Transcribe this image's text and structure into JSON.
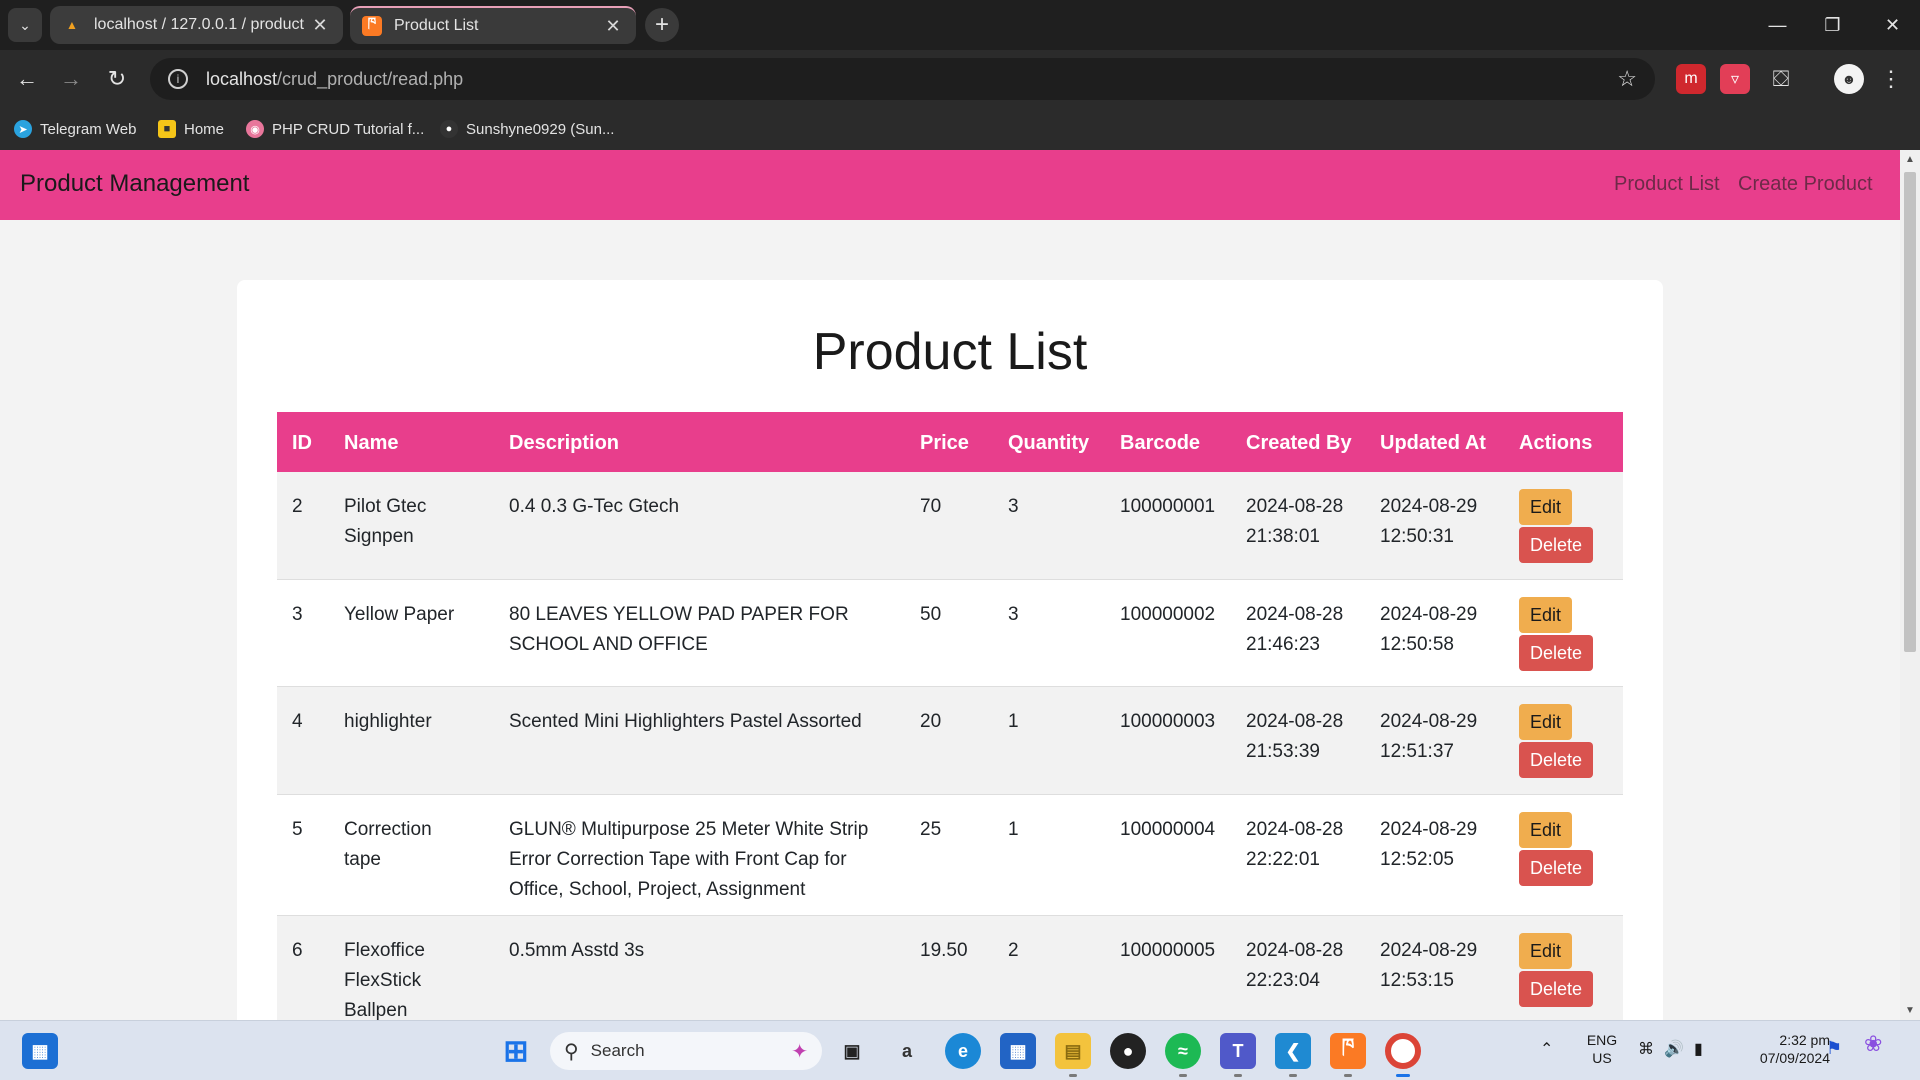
{
  "browser": {
    "tabs": [
      {
        "title": "localhost / 127.0.0.1 / product |",
        "active": false
      },
      {
        "title": "Product List",
        "active": true
      }
    ],
    "url_host": "localhost",
    "url_path": "/crud_product/read.php",
    "bookmarks": [
      "Telegram Web",
      "Home",
      "PHP CRUD Tutorial f...",
      "Sunshyne0929 (Sun..."
    ]
  },
  "navbar": {
    "brand": "Product Management",
    "links": [
      "Product List",
      "Create Product"
    ]
  },
  "page": {
    "title": "Product List",
    "columns": [
      "ID",
      "Name",
      "Description",
      "Price",
      "Quantity",
      "Barcode",
      "Created By",
      "Updated At",
      "Actions"
    ],
    "edit_label": "Edit",
    "delete_label": "Delete",
    "rows": [
      {
        "id": "2",
        "name": "Pilot Gtec Signpen",
        "description": "0.4 0.3 G-Tec Gtech",
        "price": "70",
        "quantity": "3",
        "barcode": "100000001",
        "created": "2024-08-28 21:38:01",
        "updated": "2024-08-29 12:50:31"
      },
      {
        "id": "3",
        "name": "Yellow Paper",
        "description": "80 LEAVES YELLOW PAD PAPER FOR SCHOOL AND OFFICE",
        "price": "50",
        "quantity": "3",
        "barcode": "100000002",
        "created": "2024-08-28 21:46:23",
        "updated": "2024-08-29 12:50:58"
      },
      {
        "id": "4",
        "name": "highlighter",
        "description": "Scented Mini Highlighters Pastel Assorted",
        "price": "20",
        "quantity": "1",
        "barcode": "100000003",
        "created": "2024-08-28 21:53:39",
        "updated": "2024-08-29 12:51:37"
      },
      {
        "id": "5",
        "name": "Correction tape",
        "description": "GLUN® Multipurpose 25 Meter White Strip Error Correction Tape with Front Cap for Office, School, Project, Assignment",
        "price": "25",
        "quantity": "1",
        "barcode": "100000004",
        "created": "2024-08-28 22:22:01",
        "updated": "2024-08-29 12:52:05"
      },
      {
        "id": "6",
        "name": "Flexoffice FlexStick Ballpen",
        "description": "0.5mm Asstd 3s",
        "price": "19.50",
        "quantity": "2",
        "barcode": "100000005",
        "created": "2024-08-28 22:23:04",
        "updated": "2024-08-29 12:53:15"
      }
    ]
  },
  "taskbar": {
    "search_placeholder": "Search",
    "lang_top": "ENG",
    "lang_bottom": "US",
    "time": "2:32 pm",
    "date": "07/09/2024"
  },
  "colors": {
    "accent": "#e83e8c",
    "edit": "#f0ad4e",
    "delete": "#d9534f"
  }
}
